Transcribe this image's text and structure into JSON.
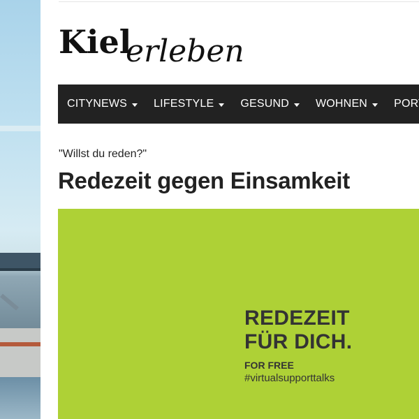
{
  "site": {
    "logo_text": "Kielerleben"
  },
  "nav": {
    "items": [
      {
        "label": "CITYNEWS",
        "has_dropdown": true
      },
      {
        "label": "LIFESTYLE",
        "has_dropdown": true
      },
      {
        "label": "GESUND",
        "has_dropdown": true
      },
      {
        "label": "WOHNEN",
        "has_dropdown": true
      },
      {
        "label": "PORTRÄ",
        "has_dropdown": false
      }
    ]
  },
  "article": {
    "kicker": "\"Willst du reden?\"",
    "title": "Redezeit gegen Einsamkeit"
  },
  "hero": {
    "background_color": "#aed136",
    "title_line1": "REDEZEIT",
    "title_line2": "FÜR DICH.",
    "subtitle": "FOR FREE",
    "hashtag": "#virtualsupporttalks"
  }
}
